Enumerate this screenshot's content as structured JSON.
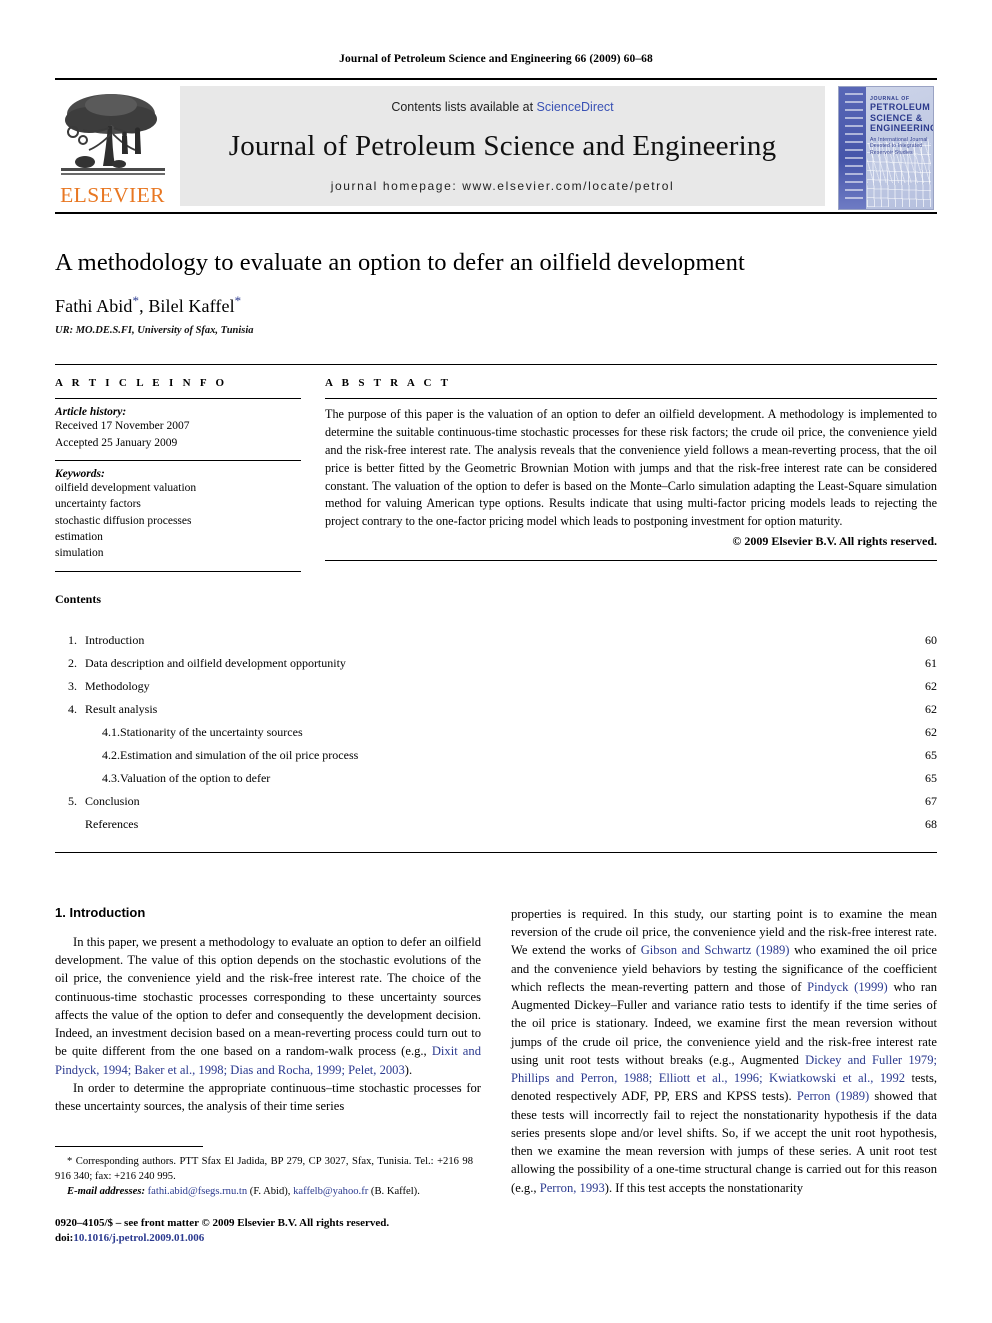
{
  "running_head": "Journal of Petroleum Science and Engineering 66 (2009) 60–68",
  "masthead": {
    "contents_prefix": "Contents lists available at",
    "sciencedirect": "ScienceDirect",
    "journal_title": "Journal of Petroleum Science and Engineering",
    "homepage": "journal homepage: www.elsevier.com/locate/petrol",
    "publisher_wordmark": "ELSEVIER",
    "cover": {
      "line1": "JOURNAL OF",
      "line2": "PETROLEUM",
      "line3": "SCIENCE &",
      "line4": "ENGINEERING",
      "line5": "An International Journal Devoted to Integrated Reservoir Studies"
    },
    "accent_orange": "#E87722",
    "link_blue": "#3a52b5"
  },
  "article": {
    "title": "A methodology to evaluate an option to defer an oilfield development",
    "authors": "Fathi Abid , Bilel Kaffel",
    "author1": "Fathi Abid",
    "author2": "Bilel Kaffel",
    "corresponding_marker": "*",
    "affiliation": "UR: MO.DE.S.FI, University of Sfax, Tunisia"
  },
  "article_info": {
    "heading": "A R T I C L E    I N F O",
    "history_label": "Article history:",
    "received": "Received 17 November 2007",
    "accepted": "Accepted 25 January 2009",
    "keywords_label": "Keywords:",
    "keywords": [
      "oilfield development valuation",
      "uncertainty factors",
      "stochastic diffusion processes",
      "estimation",
      "simulation"
    ]
  },
  "abstract": {
    "heading": "A B S T R A C T",
    "text": "The purpose of this paper is the valuation of an option to defer an oilfield development. A methodology is implemented to determine the suitable continuous-time stochastic processes for these risk factors; the crude oil price, the convenience yield and the risk-free interest rate. The analysis reveals that the convenience yield follows a mean-reverting process, that the oil price is better fitted by the Geometric Brownian Motion with jumps and that the risk-free interest rate can be considered constant. The valuation of the option to defer is based on the Monte–Carlo simulation adapting the Least-Square simulation method for valuing American type options. Results indicate that using multi-factor pricing models leads to rejecting the project contrary to the one-factor pricing model which leads to postponing investment for option maturity.",
    "copyright": "© 2009 Elsevier B.V. All rights reserved."
  },
  "contents": {
    "heading": "Contents",
    "entries": [
      {
        "num": "1.",
        "label": "Introduction",
        "page": "60",
        "sub": false
      },
      {
        "num": "2.",
        "label": "Data description and oilfield development opportunity",
        "page": "61",
        "sub": false
      },
      {
        "num": "3.",
        "label": "Methodology",
        "page": "62",
        "sub": false
      },
      {
        "num": "4.",
        "label": "Result analysis",
        "page": "62",
        "sub": false
      },
      {
        "num": "4.1.",
        "label": "Stationarity of the uncertainty sources",
        "page": "62",
        "sub": true
      },
      {
        "num": "4.2.",
        "label": "Estimation and simulation of the oil price process",
        "page": "65",
        "sub": true
      },
      {
        "num": "4.3.",
        "label": "Valuation of the option to defer",
        "page": "65",
        "sub": true
      },
      {
        "num": "5.",
        "label": "Conclusion",
        "page": "67",
        "sub": false
      },
      {
        "num": "",
        "label": "References",
        "page": "68",
        "sub": false
      }
    ]
  },
  "body": {
    "section_heading": "1. Introduction",
    "left_p1_a": "In this paper, we present a methodology to evaluate an option to defer an oilfield development. The value of this option depends on the stochastic evolutions of the oil price, the convenience yield and the risk-free interest rate. The choice of the continuous-time stochastic processes corresponding to these uncertainty sources affects the value of the option to defer and consequently the development decision. Indeed, an investment decision based on a mean-reverting process could turn out to be quite different from the one based on a random-walk process (e.g., ",
    "left_p1_cite": "Dixit and Pindyck, 1994; Baker et al., 1998; Dias and Rocha, 1999; Pelet, 2003",
    "left_p1_b": ").",
    "left_p2": "In order to determine the appropriate continuous–time stochastic processes for these uncertainty sources, the analysis of their time series",
    "right_p1_a": "properties is required. In this study, our starting point is to examine the mean reversion of the crude oil price, the convenience yield and the risk-free interest rate. We extend the works of ",
    "right_cite1": "Gibson and Schwartz (1989)",
    "right_p1_b": " who examined the oil price and the convenience yield behaviors by testing the significance of the coefficient which reflects the mean-reverting pattern and those of ",
    "right_cite2": "Pindyck (1999)",
    "right_p1_c": " who ran Augmented Dickey–Fuller and variance ratio tests to identify if the time series of the oil price is stationary. Indeed, we examine first the mean reversion without jumps of the crude oil price, the convenience yield and the risk-free interest rate using unit root tests without breaks (e.g., Augmented ",
    "right_cite3": "Dickey and Fuller 1979; Phillips and Perron, 1988; Elliott et al., 1996; Kwiatkowski et al., 1992",
    "right_p1_d": " tests, denoted respectively ADF, PP, ERS and KPSS tests). ",
    "right_cite4": "Perron (1989)",
    "right_p1_e": " showed that these tests will incorrectly fail to reject the nonstationarity hypothesis if the data series presents slope and/or level shifts. So, if we accept the unit root hypothesis, then we examine the mean reversion with jumps of these series. A unit root test allowing the possibility of a one-time structural change is carried out for this reason (e.g., ",
    "right_cite5": "Perron, 1993",
    "right_p1_f": "). If this test accepts the nonstationarity"
  },
  "footnotes": {
    "corresponding": "Corresponding authors. PTT Sfax El Jadida, BP 279, CP 3027, Sfax, Tunisia. Tel.: +216 98 916 340; fax: +216 240 995.",
    "corresponding_marker": "*",
    "email_label": "E-mail addresses:",
    "email1": "fathi.abid@fsegs.rnu.tn",
    "email1_owner": "(F. Abid),",
    "email2": "kaffelb@yahoo.fr",
    "email2_owner": "(B. Kaffel).",
    "imprint": "0920–4105/$ – see front matter © 2009 Elsevier B.V. All rights reserved.",
    "doi_label": "doi:",
    "doi": "10.1016/j.petrol.2009.01.006"
  }
}
